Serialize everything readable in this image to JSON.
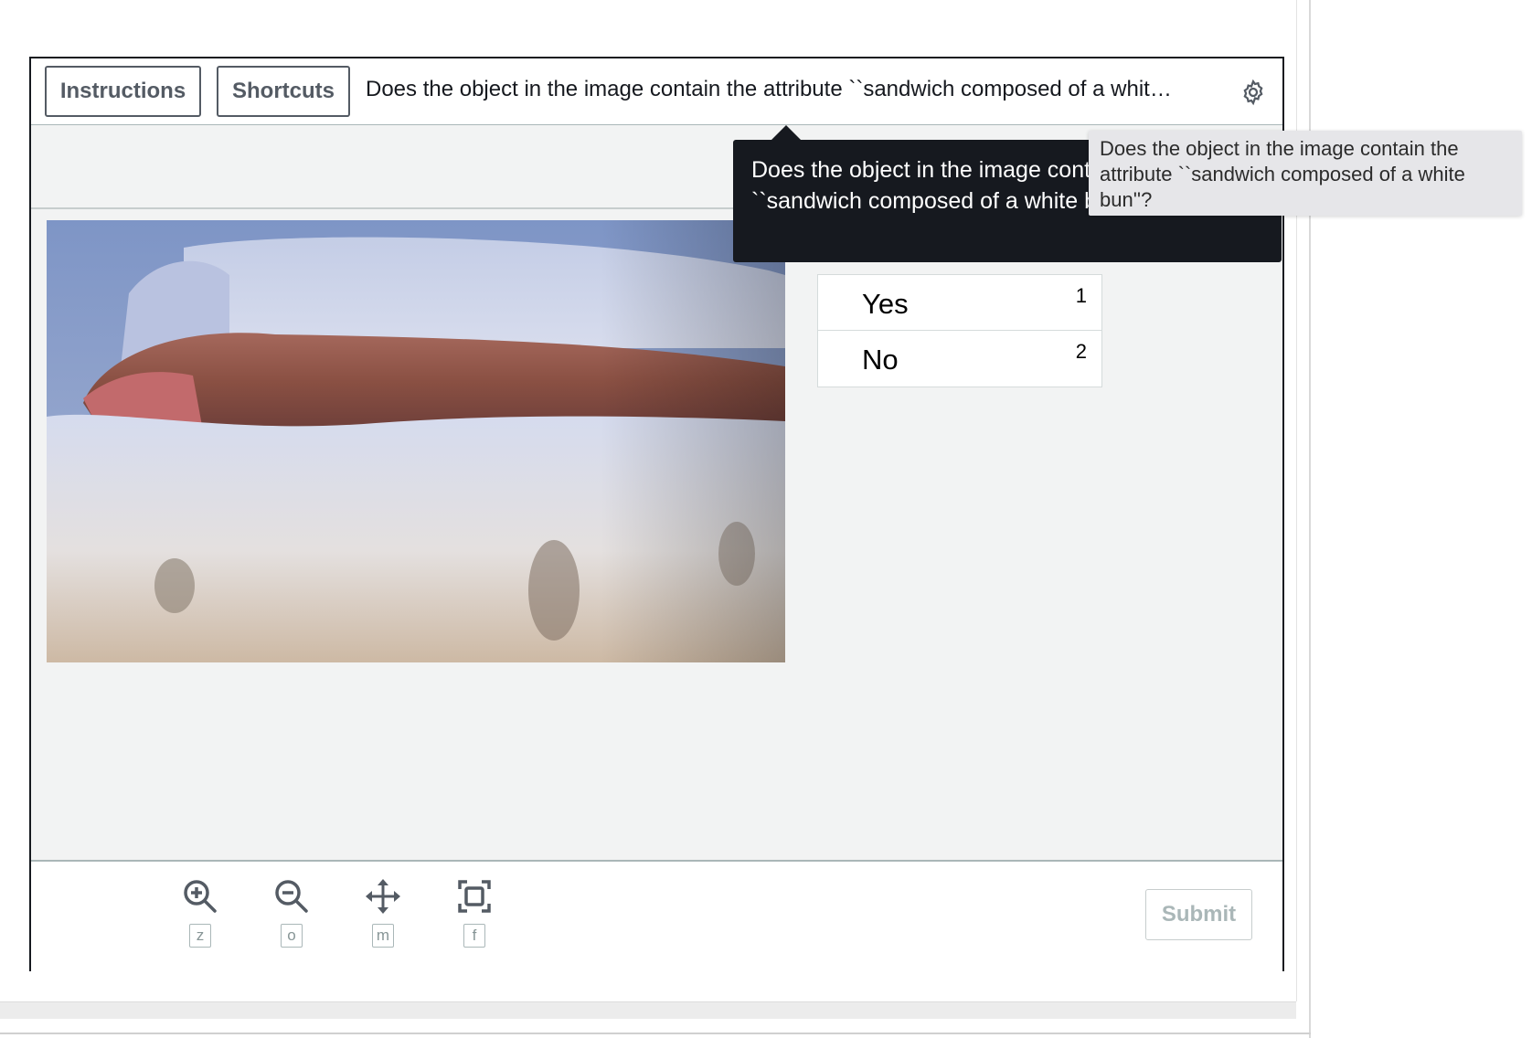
{
  "header": {
    "instructions_label": "Instructions",
    "shortcuts_label": "Shortcuts",
    "task_title": "Does the object in the image contain the attribute ``sandwich composed of a whit…",
    "settings_icon": "gear-icon"
  },
  "tooltip": {
    "text": "Does the object in the image contain the attribute ``sandwich composed of a white bun\"?"
  },
  "native_tooltip": {
    "text": "Does the object in the image contain the attribute ``sandwich composed of a white bun''?"
  },
  "choices": [
    {
      "label": "Yes",
      "key": "1"
    },
    {
      "label": "No",
      "key": "2"
    }
  ],
  "toolbar": {
    "tools": [
      {
        "icon": "zoom-in-icon",
        "key": "z"
      },
      {
        "icon": "zoom-out-icon",
        "key": "o"
      },
      {
        "icon": "move-icon",
        "key": "m"
      },
      {
        "icon": "fit-screen-icon",
        "key": "f"
      }
    ],
    "submit_label": "Submit"
  },
  "colors": {
    "canvas_bg": "#f2f3f3",
    "frame_border": "#16191f",
    "tooltip_bg": "#16191f",
    "disabled_text": "#aab7b8"
  }
}
